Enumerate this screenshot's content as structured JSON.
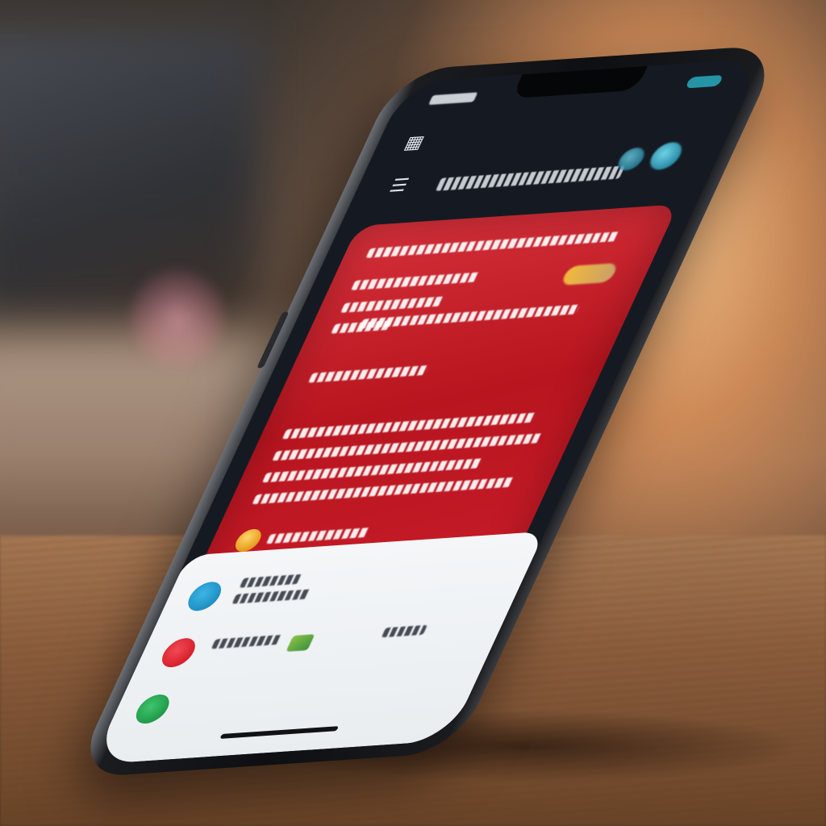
{
  "scene": {
    "subject": "smartphone",
    "app_theme_colors": {
      "header": "#151a22",
      "card": "#c41c27",
      "accent_button": "#f5c132",
      "sheet": "#f1f4f6"
    }
  },
  "screen": {
    "header": {
      "icons": [
        "grid-icon",
        "menu-icon",
        "avatar-icon"
      ]
    },
    "card": {
      "icons": [
        "coin-icon",
        "badge-icon",
        "camera-icon",
        "gallery-icon"
      ]
    },
    "sheet": {
      "rows": [
        {
          "icon": "chat-bubble-icon",
          "color": "#1f8fc2"
        },
        {
          "icon": "location-pin-icon",
          "color": "#d81f2c"
        },
        {
          "icon": "contact-icon",
          "color": "#1f9a4a"
        }
      ]
    }
  }
}
